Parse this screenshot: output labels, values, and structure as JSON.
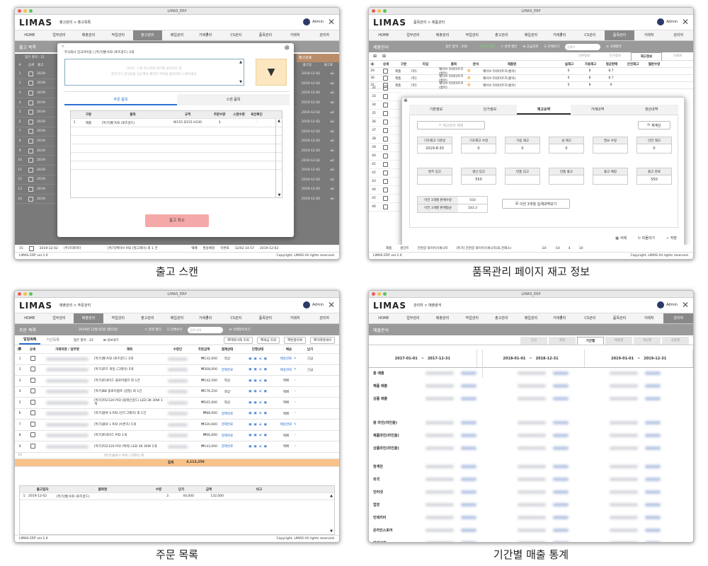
{
  "app": {
    "window_title": "LIMAS_ERP",
    "logo": "LIMAS",
    "admin": "Admin",
    "version": "LIMAS ERP ver.1.0",
    "copyright": "Copyright. LIMAS All rights reserved.",
    "menu": [
      "HOME",
      "업무관리",
      "매출관리",
      "작업관리",
      "출고관리",
      "매입관리",
      "거래관리",
      "CS관리",
      "품목관리",
      "거래처",
      "관리자"
    ],
    "menu_badge": "1"
  },
  "q1": {
    "caption": "출고 스캔",
    "breadcrumb": "출고관리 > 출고목록",
    "subtitle": "출고 목록",
    "count": "찾은 항목 : 21",
    "cols": [
      "#",
      "상세",
      "출고"
    ],
    "rows": [
      "1",
      "2",
      "3",
      "4",
      "5",
      "6",
      "7",
      "8",
      "9",
      "10",
      "11",
      "12",
      "13",
      "14",
      "15"
    ],
    "row_prefix": "2019-",
    "dates": [
      "2019-12-02",
      "2019-12-02",
      "2019-12-02",
      "2019-12-02",
      "2019-12-02",
      "2019-12-02",
      "2019-12-02",
      "2019-12-02",
      "2019-12-02",
      "2019-12-02",
      "2019-12-02",
      "2019-12-02",
      "2019-12-02",
      "2019-12-02",
      "2019-12-02"
    ],
    "right_header": "출고완료",
    "right_cols": [
      "출고일",
      "출고표"
    ],
    "last_row": {
      "num": "15",
      "date": "2019-12-02",
      "company": "(주)프레이터",
      "item": "[특가]케이브 P/D (필그레이) 외 1 건",
      "a": "택배",
      "b": "발송예정",
      "c": "미완료",
      "d": "12/02 14:57",
      "e": "2019-12-02"
    },
    "modal": {
      "info": "주식회사 망고아이랑 | [특가]벨 P/D (로즈골드) 3개",
      "hint1": "바코드 스캔 하시려면 여기를 클릭하신 후",
      "hint2": "외부기기 방식처럼 당신께서 페이지 주변을 클릭하지 스캔하세요.",
      "tab1": "주문 품목",
      "tab2": "스캔 품목",
      "cols": [
        "구분",
        "품목",
        "규격",
        "주문수량",
        "스캔수량",
        "육안확인"
      ],
      "row": {
        "num": "1",
        "type": "제품",
        "item": "[특가]벨 P/D (로즈골드)",
        "spec": "W155 D155 H230",
        "qty": "3"
      },
      "cancel": "출고 취소"
    }
  },
  "q2": {
    "caption": "품목관리 페이지 재고 정보",
    "breadcrumb": "품목관리 > 제품관리",
    "subtitle": "제품관리",
    "count": "찾은 항목 : 318",
    "toolbar": [
      "삭제된 제품",
      "검색 필터",
      "고급검색",
      "전체보기"
    ],
    "search_placeholder": "검색어",
    "delete_all": "삭제항목",
    "tabs": [
      "기본정보",
      "단가정보",
      "재고정보",
      "거래처"
    ],
    "cols": [
      "상세",
      "구분",
      "타입",
      "품목",
      "분석",
      "제품명",
      "",
      "실재고",
      "가용재고",
      "평균판매",
      "안전재고",
      "월판수량"
    ],
    "rows": [
      {
        "n": "29",
        "type": "제품",
        "t": "기타",
        "item": "웨이브 타워이트즈(롱아)",
        "name": "웨이브 타워이트즈(롱아)",
        "x": "",
        "a": "0",
        "b": "8",
        "c": "8.7"
      },
      {
        "n": "30",
        "type": "제품",
        "t": "기타",
        "item": "웨이브 타워이트즈(롱아)",
        "name": "웨이브 타워이트즈(롱아)",
        "x": "",
        "a": "0",
        "b": "8",
        "c": "8.7"
      },
      {
        "n": "31",
        "type": "제품",
        "t": "기타",
        "item": "웨이브 타워이트즈(롱아)",
        "name": "웨이브 타워이트즈(롱아)",
        "x": "",
        "a": "0",
        "b": "8",
        "c": "9"
      }
    ],
    "side_rows": [
      "32",
      "33",
      "34",
      "35",
      "36",
      "37",
      "38",
      "39",
      "40",
      "41",
      "42",
      "43",
      "44",
      "45",
      "46"
    ],
    "last_row": {
      "type": "제품",
      "t": "원단트",
      "item": "전천장 와이어기세시지",
      "name": "[특가] 전천장 와이어기세시지(표,전래소)",
      "a": "-10",
      "b": "-10",
      "c": "4",
      "d": "10"
    },
    "modal": {
      "tabs": [
        "기본정보",
        "단가정보",
        "재고요약",
        "거래내역",
        "생산내역"
      ],
      "reset": "재고관리 제외",
      "refresh": "재계산",
      "labels1": [
        "기초재고 기준일",
        "기초재고 수량",
        "가용 재고",
        "실 재고",
        "필요 수량",
        "안전 재고"
      ],
      "values1": [
        "2019-8-30",
        "0",
        "0",
        "0",
        "",
        "0"
      ],
      "labels2": [
        "발주 입고",
        "생산 입고",
        "반품 입고",
        "반품 출고",
        "출고 예정",
        "출고 완료"
      ],
      "values2": [
        "",
        "550",
        "",
        "",
        "",
        "550"
      ],
      "avg_labels": [
        "이전 3개월 판매수량",
        "이전 3개월 판매평균"
      ],
      "avg_values": [
        "550",
        "183.3"
      ],
      "history_btn": "이전 3개월 집계내역보기",
      "delete": "삭제",
      "restore": "되돌리기",
      "save": "저장"
    }
  },
  "q3": {
    "caption": "주문 목록",
    "breadcrumb": "매출관리 > 주문관리",
    "subtitle": "주문 목록",
    "date": "2019년 12월 02일 (월요일)",
    "filters": [
      "검색 필터",
      "전체보기"
    ],
    "search_placeholder": "검색 검색",
    "delete_items": "삭제항목보기",
    "tabs": [
      "일일목록",
      "기간목록"
    ],
    "count": "찾은 항목 : 22",
    "download": "내보내기",
    "actions": [
      "계좌거래 조회",
      "세금 조회",
      "반품목록",
      "거래명세서"
    ],
    "cols": [
      "#",
      "상세",
      "거래처명 / 담부명",
      "제목",
      "수량인",
      "주문금액",
      "결제상태",
      "진행상태",
      "배송",
      "납기"
    ],
    "rows": [
      {
        "n": "1",
        "title": "[특가]벨 P/D (로즈골드) 3개",
        "amt": "₩132,000",
        "pay": "외상",
        "ship": "배송완료",
        "due": "긴급"
      },
      {
        "n": "2",
        "title": "[특가]포트 박등 (그레이) 5개",
        "amt": "₩308,000",
        "pay": "결제완료",
        "ship": "배송완료",
        "due": "긴급"
      },
      {
        "n": "3",
        "title": "[특가]토네이드 플로어램프 외 1건",
        "amt": "₩142,500",
        "pay": "외상",
        "ship": "택배",
        "due": ""
      },
      {
        "n": "4",
        "title": "[특가]BB 플로어램프 (검정) 외 1건",
        "amt": "₩176,250",
        "pay": "외상",
        "ship": "택배",
        "due": ""
      },
      {
        "n": "5",
        "title": "[특가]지오120 P/D (블랙인골드) LED 3K 30W 1개",
        "amt": "₩165,000",
        "pay": "외상",
        "ship": "택배",
        "due": ""
      },
      {
        "n": "6",
        "title": "[특가]플루 S P/D (인드그레이) 외 1건",
        "amt": "₩88,000",
        "pay": "결제완료",
        "ship": "택배",
        "due": ""
      },
      {
        "n": "7",
        "title": "[특가]플루 L P/D (브론즈) 5개",
        "amt": "₩330,000",
        "pay": "결제완료",
        "ship": "배송완료",
        "due": ""
      },
      {
        "n": "8",
        "title": "[특가]토네이드 P/D 1개",
        "amt": "₩66,000",
        "pay": "결제완료",
        "ship": "택배",
        "due": ""
      },
      {
        "n": "9",
        "title": "[특가]지오120 P/D (백색) LED 3K 30W 1개",
        "amt": "₩143,000",
        "pay": "결제완료",
        "ship": "택배",
        "due": ""
      }
    ],
    "partial_row": {
      "n": "10",
      "title": "[특가]클로스 P/D (그레이) 외"
    },
    "total_label": "합계",
    "total_amount": "4,113,250",
    "detail_cols": [
      "출고일자",
      "품목명",
      "수량",
      "단가",
      "금액",
      "비고"
    ],
    "detail_row": {
      "n": "1",
      "date": "2019-12-02",
      "item": "[특가]벨 P/D (로즈골드)",
      "qty": "3",
      "price": "44,000",
      "amt": "132,000"
    }
  },
  "q4": {
    "caption": "기간별 매출 통계",
    "breadcrumb": "관리자 > 매출분석",
    "subtitle": "매출분석",
    "tabs": [
      "일일",
      "월별",
      "기간별",
      "제품별",
      "색상별",
      "상품별"
    ],
    "ranges": [
      {
        "from": "2017-01-01",
        "to": "2017-12-31"
      },
      {
        "from": "2018-01-01",
        "to": "2018-12-31"
      },
      {
        "from": "2019-01-01",
        "to": "2019-12-31"
      }
    ],
    "range_sep": "~",
    "labels_a": [
      "총 매출",
      "제품 매출",
      "상품 매출"
    ],
    "labels_b": [
      "총 마진(마진율)",
      "제품마진(마진율)",
      "상품마진(마진율)"
    ],
    "labels_c": [
      "청계천",
      "외국",
      "인터넷",
      "업장",
      "인테리어",
      "온라인스토어",
      "판매고객"
    ]
  },
  "colors": {
    "accent": "#f7c28a",
    "header_gray": "#9a9a9a",
    "salmon": "#f4a9a8",
    "blue": "#2e6fd1"
  }
}
